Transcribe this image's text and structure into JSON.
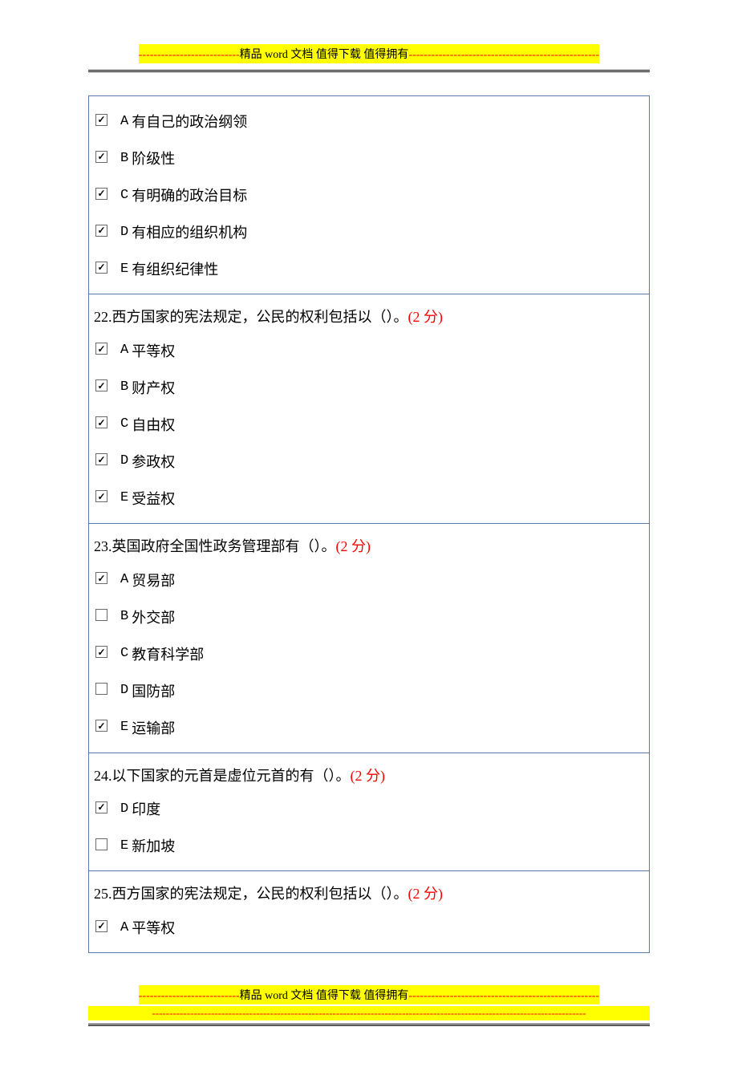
{
  "banner": {
    "dashes_before": "---------------------------",
    "text_pre": "精品",
    "text_word": " word ",
    "text_mid": "文档  值得下载  值得拥有",
    "dashes_after": "---------------------------------------------------",
    "line2": "-----------------------------------------------------------------------------------------------------------------------------"
  },
  "questions": [
    {
      "number": "",
      "text": "",
      "points": "",
      "options": [
        {
          "letter": "A",
          "label": "有自己的政治纲领",
          "checked": true
        },
        {
          "letter": "B",
          "label": "阶级性",
          "checked": true
        },
        {
          "letter": "C",
          "label": "有明确的政治目标",
          "checked": true
        },
        {
          "letter": "D",
          "label": "有相应的组织机构",
          "checked": true
        },
        {
          "letter": "E",
          "label": "有组织纪律性",
          "checked": true
        }
      ]
    },
    {
      "number": "22.",
      "text": "西方国家的宪法规定，公民的权利包括以（）。",
      "points": "(2 分)",
      "options": [
        {
          "letter": "A",
          "label": "平等权",
          "checked": true
        },
        {
          "letter": "B",
          "label": "财产权",
          "checked": true
        },
        {
          "letter": "C",
          "label": "自由权",
          "checked": true
        },
        {
          "letter": "D",
          "label": "参政权",
          "checked": true
        },
        {
          "letter": "E",
          "label": "受益权",
          "checked": true
        }
      ]
    },
    {
      "number": "23.",
      "text": "英国政府全国性政务管理部有（）。",
      "points": "(2 分)",
      "options": [
        {
          "letter": "A",
          "label": "贸易部",
          "checked": true
        },
        {
          "letter": "B",
          "label": "外交部",
          "checked": false
        },
        {
          "letter": "C",
          "label": "教育科学部",
          "checked": true
        },
        {
          "letter": "D",
          "label": "国防部",
          "checked": false
        },
        {
          "letter": "E",
          "label": "运输部",
          "checked": true
        }
      ]
    },
    {
      "number": "24.",
      "text": "以下国家的元首是虚位元首的有（）。",
      "points": "(2 分)",
      "options": [
        {
          "letter": "D",
          "label": "印度",
          "checked": true
        },
        {
          "letter": "E",
          "label": "新加坡",
          "checked": false
        }
      ]
    },
    {
      "number": "25.",
      "text": "西方国家的宪法规定，公民的权利包括以（）。",
      "points": "(2 分)",
      "options": [
        {
          "letter": "A",
          "label": "平等权",
          "checked": true
        }
      ]
    }
  ]
}
